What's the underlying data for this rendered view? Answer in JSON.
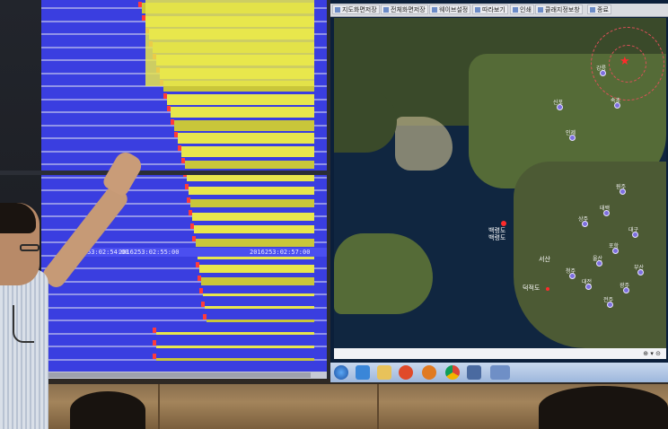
{
  "seismograph": {
    "timestamps": [
      "2016253:02:54:00",
      "2016253:02:55:00",
      "2016253:02:57:00"
    ]
  },
  "map": {
    "toolbar": [
      {
        "label": "지도화면저장",
        "icon": "save-icon"
      },
      {
        "label": "전체화면저장",
        "icon": "screen-save-icon"
      },
      {
        "label": "웨이브설정",
        "icon": "wave-settings-icon"
      },
      {
        "label": "따라보기",
        "icon": "follow-icon"
      },
      {
        "label": "인쇄",
        "icon": "print-icon"
      },
      {
        "label": "클래지정보창",
        "icon": "info-window-icon"
      },
      {
        "label": "종료",
        "icon": "exit-icon"
      }
    ],
    "labels": {
      "baengnyeong_1": "백령도",
      "baengnyeong_2": "백령도",
      "deokjeok": "덕적도",
      "seosan": "서산"
    },
    "city_labels": [
      "신포",
      "강릉",
      "속초",
      "인제",
      "원주",
      "태백",
      "상주",
      "대구",
      "포항",
      "울산",
      "부산",
      "광주",
      "전주",
      "대전",
      "청주"
    ]
  },
  "taskbar": {
    "icons": [
      "start-orb-icon",
      "ie-browser-icon",
      "folder-icon",
      "media-player-icon",
      "firefox-icon",
      "chrome-icon",
      "app-window-icon"
    ]
  },
  "colors": {
    "seismo_background": "#3a3ee0",
    "trace_yellow": "#e8e64c",
    "marker_red": "#ff3b3b",
    "map_sea": "#102640",
    "station_purple": "#7d6fe0"
  }
}
